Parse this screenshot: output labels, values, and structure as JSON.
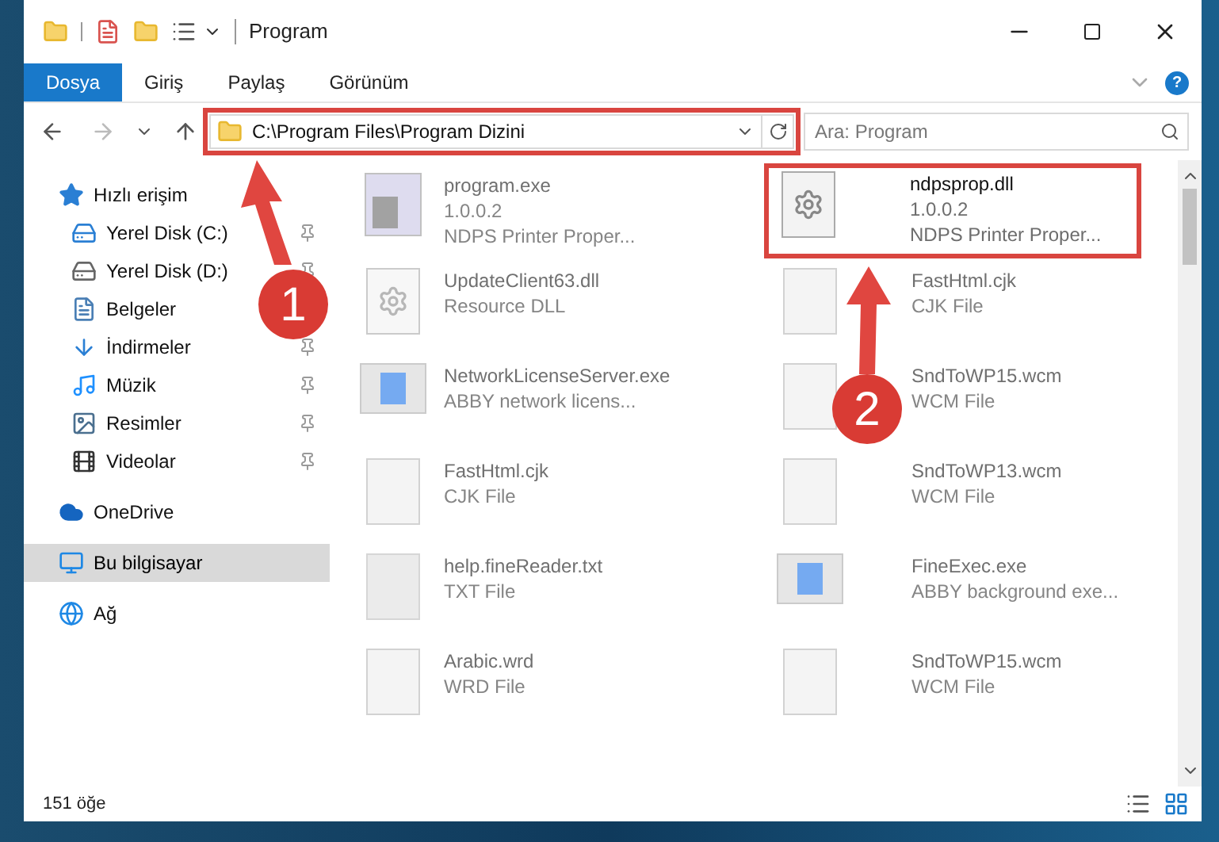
{
  "window": {
    "title": "Program"
  },
  "ribbon_tabs": [
    {
      "label": "Dosya",
      "selected": true
    },
    {
      "label": "Giriş",
      "selected": false
    },
    {
      "label": "Paylaş",
      "selected": false
    },
    {
      "label": "Görünüm",
      "selected": false
    }
  ],
  "ribbon_help": "?",
  "address_bar": {
    "path": "C:\\Program Files\\Program Dizini"
  },
  "search": {
    "placeholder": "Ara: Program"
  },
  "nav_pane": [
    {
      "label": "Hızlı erişim",
      "kind": "star",
      "selected": false,
      "children": [
        {
          "label": "Yerel Disk (C:)",
          "kind": "drive-windows",
          "pinned": true,
          "selected": false
        },
        {
          "label": "Yerel Disk (D:)",
          "kind": "drive",
          "pinned": true,
          "selected": false
        },
        {
          "label": "Belgeler",
          "kind": "document",
          "pinned": false,
          "selected": false
        },
        {
          "label": "İndirmeler",
          "kind": "download",
          "pinned": true,
          "selected": false
        },
        {
          "label": "Müzik",
          "kind": "music",
          "pinned": true,
          "selected": false
        },
        {
          "label": "Resimler",
          "kind": "pictures",
          "pinned": true,
          "selected": false
        },
        {
          "label": "Videolar",
          "kind": "video",
          "pinned": true,
          "selected": false
        }
      ]
    },
    {
      "label": "OneDrive",
      "kind": "cloud",
      "selected": false
    },
    {
      "label": "Bu bilgisayar",
      "kind": "computer",
      "selected": true
    },
    {
      "label": "Ağ",
      "kind": "network",
      "selected": false
    }
  ],
  "files": [
    {
      "name": "program.exe",
      "details": [
        "1.0.0.2",
        "NDPS Printer Proper..."
      ],
      "kind": "app",
      "blurred": true
    },
    {
      "name": "ndpsprop.dll",
      "details": [
        "1.0.0.2",
        "NDPS Printer Proper..."
      ],
      "kind": "settings",
      "blurred": false
    },
    {
      "name": "UpdateClient63.dll",
      "details": [
        "Resource DLL"
      ],
      "kind": "settings",
      "blurred": true
    },
    {
      "name": "FastHtml.cjk",
      "details": [
        "CJK File"
      ],
      "kind": "blank",
      "blurred": true
    },
    {
      "name": "NetworkLicenseServer.exe",
      "details": [
        "ABBY network licens..."
      ],
      "kind": "window",
      "blurred": true
    },
    {
      "name": "SndToWP15.wcm",
      "details": [
        "WCM File"
      ],
      "kind": "blank",
      "blurred": true
    },
    {
      "name": "FastHtml.cjk",
      "details": [
        "CJK File"
      ],
      "kind": "blank",
      "blurred": true
    },
    {
      "name": "SndToWP13.wcm",
      "details": [
        "WCM File"
      ],
      "kind": "blank",
      "blurred": true
    },
    {
      "name": "help.fineReader.txt",
      "details": [
        "TXT File"
      ],
      "kind": "text",
      "blurred": true
    },
    {
      "name": "FineExec.exe",
      "details": [
        "ABBY background exe..."
      ],
      "kind": "window",
      "blurred": true
    },
    {
      "name": "Arabic.wrd",
      "details": [
        "WRD File"
      ],
      "kind": "blank",
      "blurred": true
    },
    {
      "name": "SndToWP15.wcm",
      "details": [
        "WCM File"
      ],
      "kind": "blank",
      "blurred": true
    }
  ],
  "status_bar": {
    "count": "151 öğe"
  },
  "annotations": [
    {
      "number": "1"
    },
    {
      "number": "2"
    }
  ]
}
